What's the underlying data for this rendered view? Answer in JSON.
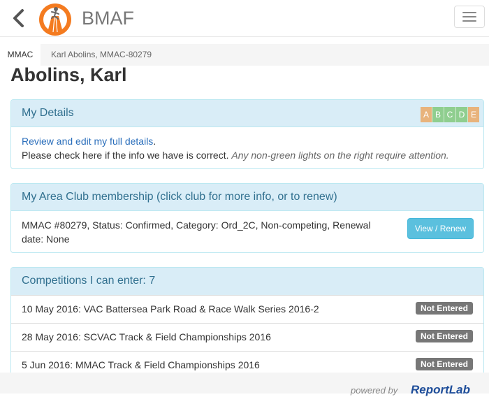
{
  "nav": {
    "brand": "BMAF",
    "back_icon": "chevron-left-icon",
    "logo_icon": "runner-logo-icon",
    "menu_icon": "hamburger-icon"
  },
  "breadcrumb": {
    "active": "MMAC",
    "current": "Karl Abolins, MMAC-80279"
  },
  "page_title": "Abolins, Karl",
  "details": {
    "heading": "My Details",
    "link_text": "Review and edit my full details",
    "link_suffix": ".",
    "line2": "Please check here if the info we have is correct.",
    "line2_hint": "Any non-green lights on the right require attention.",
    "lights": [
      {
        "label": "A",
        "color": "#e8b37c"
      },
      {
        "label": "B",
        "color": "#8fce8f"
      },
      {
        "label": "C",
        "color": "#8fce8f"
      },
      {
        "label": "D",
        "color": "#8fce8f"
      },
      {
        "label": "E",
        "color": "#e8b37c"
      }
    ]
  },
  "membership": {
    "heading": "My Area Club membership (click club for more info, or to renew)",
    "text": "MMAC #80279,  Status: Confirmed,  Category: Ord_2C,  Non-competing,  Renewal date: None",
    "button": "View / Renew"
  },
  "competitions": {
    "heading": "Competitions I can enter: 7",
    "items": [
      {
        "label": "10 May 2016: VAC Battersea Park Road & Race Walk Series 2016-2",
        "status": "Not Entered"
      },
      {
        "label": "28 May 2016: SCVAC Track & Field Championships 2016",
        "status": "Not Entered"
      },
      {
        "label": "5 Jun 2016: MMAC Track & Field Championships 2016",
        "status": "Not Entered"
      }
    ]
  },
  "footer": {
    "powered_by": "powered by",
    "brand": "ReportLab"
  },
  "colors": {
    "panel_head_bg": "#d9edf7",
    "panel_head_text": "#31708f",
    "link": "#2a6ebb",
    "info_button": "#5bc0de",
    "badge": "#777777"
  }
}
